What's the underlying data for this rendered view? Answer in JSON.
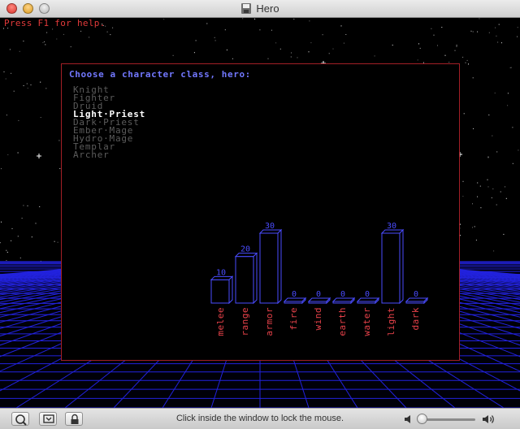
{
  "window": {
    "title": "Hero"
  },
  "game": {
    "help_text": "Press F1 for help.",
    "prompt": "Choose a character class, hero:",
    "classes": [
      "Knight",
      "Fighter",
      "Druid",
      "Light Priest",
      "Dark Priest",
      "Ember Mage",
      "Hydro Mage",
      "Templar",
      "Archer"
    ],
    "selected_class": "Light Priest",
    "colors": {
      "prompt": "#7278ff",
      "help": "#e23a3a",
      "panel_border": "#a31f26",
      "bar": "#4a4cff",
      "stat_label": "#e8424a",
      "class_selected": "#ffffff",
      "class_unselected": "#5c5c5c",
      "grid": "#2222dd"
    }
  },
  "chart_data": {
    "type": "bar",
    "categories": [
      "melee",
      "range",
      "armor",
      "fire",
      "wind",
      "earth",
      "water",
      "light",
      "dark"
    ],
    "values": [
      10,
      20,
      30,
      0,
      0,
      0,
      0,
      30,
      0
    ],
    "ylim": [
      0,
      30
    ]
  },
  "statusbar": {
    "hint": "Click inside the window to lock the mouse.",
    "icons": [
      "zoom-icon",
      "screen-icon",
      "lock-icon",
      "volume-low-icon",
      "volume-high-icon"
    ]
  }
}
